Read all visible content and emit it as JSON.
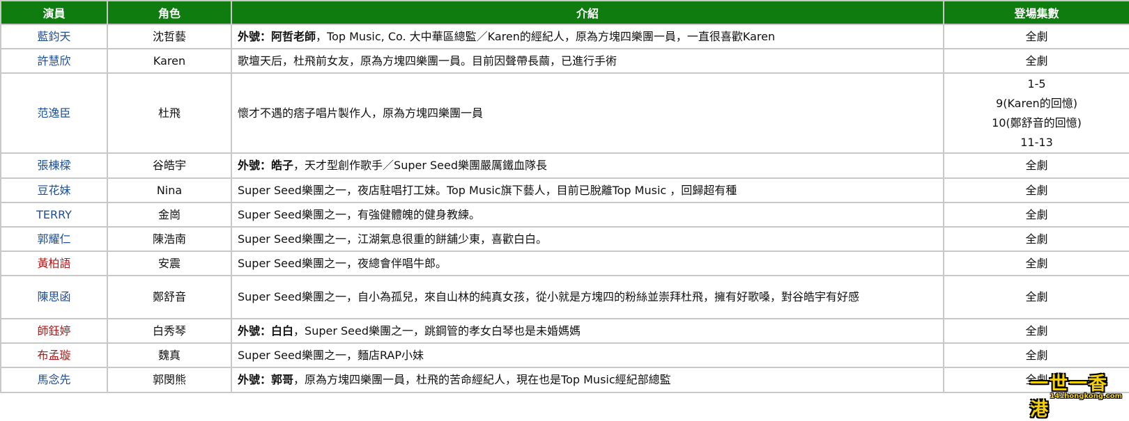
{
  "headers": [
    "演員",
    "角色",
    "介紹",
    "登場集數"
  ],
  "colors": {
    "header_bg": "#0f7c0f",
    "actor_blue": "#1a4e9a",
    "actor_red": "#b01818",
    "border": "#c8c8c8"
  },
  "rows": [
    {
      "actor": "藍鈞天",
      "role": "沈哲藝",
      "nick_label": "外號：",
      "nick": "阿哲老師",
      "desc": "，Top Music, Co. 大中華區總監／Karen的經紀人，原為方塊四樂團一員，一直很喜歡Karen",
      "episodes": [
        "全劇"
      ]
    },
    {
      "actor": "許慧欣",
      "role": "Karen",
      "desc": "歌壇天后，杜飛前女友，原為方塊四樂團一員。目前因聲帶長繭，已進行手術",
      "episodes": [
        "全劇"
      ]
    },
    {
      "actor": "范逸臣",
      "role": "杜飛",
      "desc": "懷才不遇的痞子唱片製作人，原為方塊四樂團一員",
      "episodes": [
        "1-5",
        "9(Karen的回憶)",
        "10(鄭舒音的回憶)",
        "11-13"
      ]
    },
    {
      "actor": "張棟樑",
      "role": "谷皓宇",
      "nick_label": "外號：",
      "nick": "皓子",
      "desc": "，天才型創作歌手／Super Seed樂團嚴厲鐵血隊長",
      "episodes": [
        "全劇"
      ]
    },
    {
      "actor": "豆花妹",
      "role": "Nina",
      "desc": "Super Seed樂團之一，夜店駐唱打工妹。Top Music旗下藝人，目前已脫離Top Music ，回歸超有種",
      "episodes": [
        "全劇"
      ]
    },
    {
      "actor": "TERRY",
      "role": "金崗",
      "desc": "Super Seed樂團之一，有強健體魄的健身教練。",
      "episodes": [
        "全劇"
      ]
    },
    {
      "actor": "郭耀仁",
      "role": "陳浩南",
      "desc": "Super Seed樂團之一，江湖氣息很重的餅舖少東，喜歡白白。",
      "episodes": [
        "全劇"
      ]
    },
    {
      "actor": "黃柏語",
      "role": "安震",
      "desc": "Super Seed樂團之一，夜總會伴唱牛郎。",
      "episodes": [
        "全劇"
      ]
    },
    {
      "actor": "陳思函",
      "role": "鄭舒音",
      "desc": "Super Seed樂團之一，自小為孤兒，來自山林的純真女孩，從小就是方塊四的粉絲並崇拜杜飛，擁有好歌嗓，對谷皓宇有好感",
      "episodes": [
        "全劇"
      ]
    },
    {
      "actor": "師鈺婷",
      "role": "白秀琴",
      "nick_label": "外號：",
      "nick": "白白",
      "desc": "，Super Seed樂團之一，跳鋼管的孝女白琴也是未婚媽媽",
      "episodes": [
        "全劇"
      ]
    },
    {
      "actor": "布孟璇",
      "role": "魏真",
      "desc": "Super Seed樂團之一，麵店RAP小妹",
      "episodes": [
        "全劇"
      ]
    },
    {
      "actor": "馬念先",
      "role": "郭閔熊",
      "nick_label": "外號：",
      "nick": "郭哥",
      "desc": "，原為方塊四樂團一員，杜飛的苦命經紀人，現在也是Top Music經紀部總監",
      "episodes": [
        "全劇"
      ]
    }
  ],
  "watermark": {
    "main": "一世一香港",
    "sub": "141hongkong.com"
  }
}
